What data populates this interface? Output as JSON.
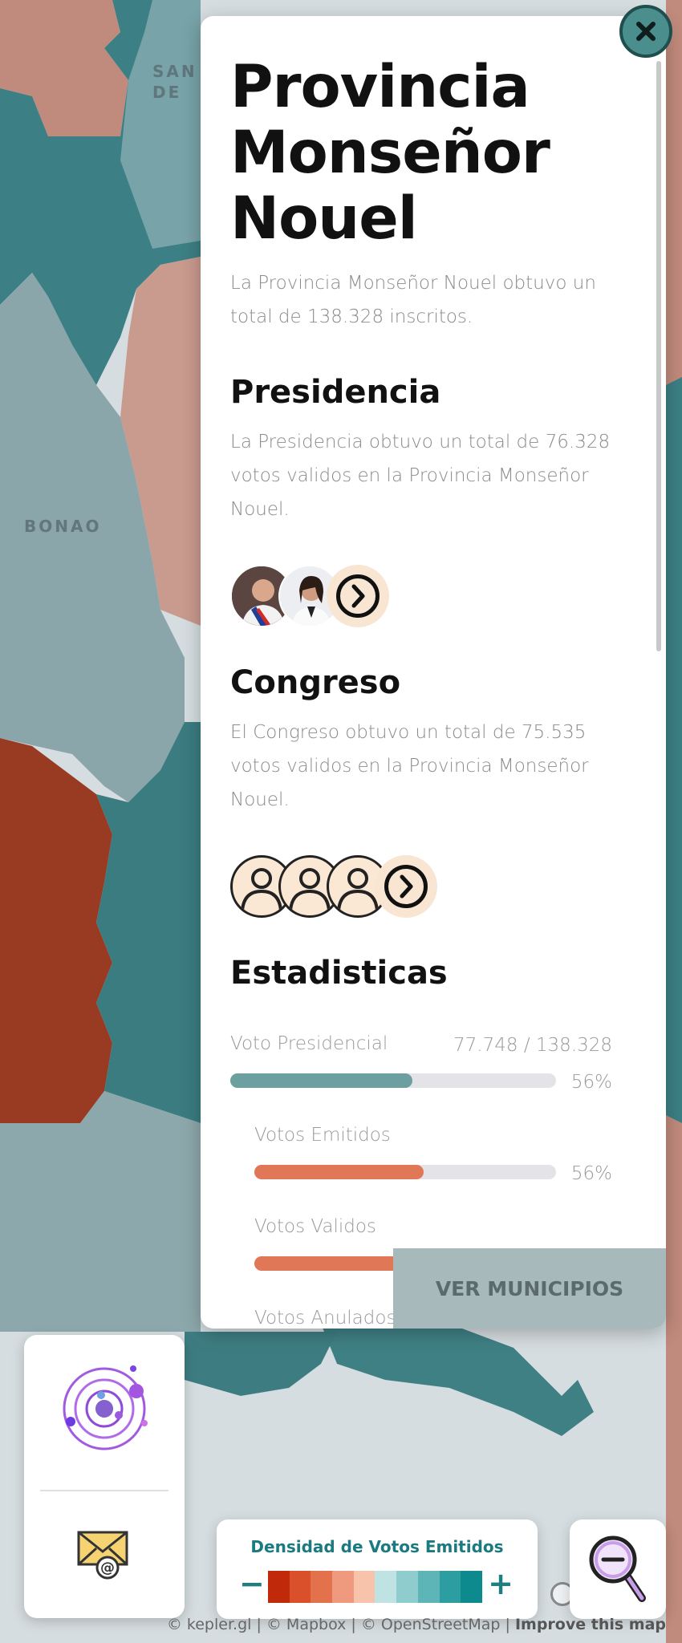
{
  "map": {
    "labels": {
      "top": "SAN\nDE",
      "bonao": "BONAO"
    },
    "colors": {
      "teal": "#3a7b80",
      "slate": "#8ba7ab",
      "salmon": "#c28c80",
      "pink": "#cfa7a0",
      "rust": "#9a3a22",
      "light": "#d5dde0"
    }
  },
  "panel": {
    "title": "Provincia Monseñor Nouel",
    "intro": "La Provincia Monseñor Nouel obtuvo un total de 138.328 inscritos.",
    "presidencia": {
      "heading": "Presidencia",
      "text": "La Presidencia obtuvo un total de 76.328 votos validos en la Provincia Monseñor Nouel."
    },
    "congreso": {
      "heading": "Congreso",
      "text": "El Congreso obtuvo un total de 75.535 votos validos en la Provincia Monseñor Nouel."
    },
    "estadisticas": {
      "heading": "Estadisticas",
      "items": [
        {
          "label": "Voto Presidencial",
          "value": "77.748 / 138.328",
          "percent_label": "56%",
          "fraction": 0.56,
          "color": "#6b9fa0"
        },
        {
          "label": "Votos Emitidos",
          "value": "",
          "percent_label": "56%",
          "fraction": 0.56,
          "color": "#e07756"
        },
        {
          "label": "Votos Validos",
          "value": "",
          "percent_label": "",
          "fraction": 0.56,
          "color": "#e07756"
        },
        {
          "label": "Votos Anulados",
          "value": "",
          "percent_label": "",
          "fraction": 0.0,
          "color": "#e07756"
        }
      ]
    },
    "ver_municipios": "VER MUNICIPIOS"
  },
  "legend": {
    "title": "Densidad de Votos Emitidos",
    "minus": "−",
    "plus": "+",
    "colors": [
      "#c02a0a",
      "#d9502a",
      "#e2714c",
      "#ef9a7e",
      "#f7c3ab",
      "#bfe2e2",
      "#8ecccd",
      "#5db5b7",
      "#2c9da0",
      "#0c8a8d"
    ]
  },
  "icons": {
    "close": "close-icon",
    "orbit": "orbit-logo-icon",
    "mail": "email-icon",
    "zoom_out": "zoom-out-icon",
    "next": "chevron-right-icon"
  },
  "attribution": {
    "text": "© kepler.gl | © Mapbox | © OpenStreetMap | ",
    "link": "Improve this map"
  }
}
